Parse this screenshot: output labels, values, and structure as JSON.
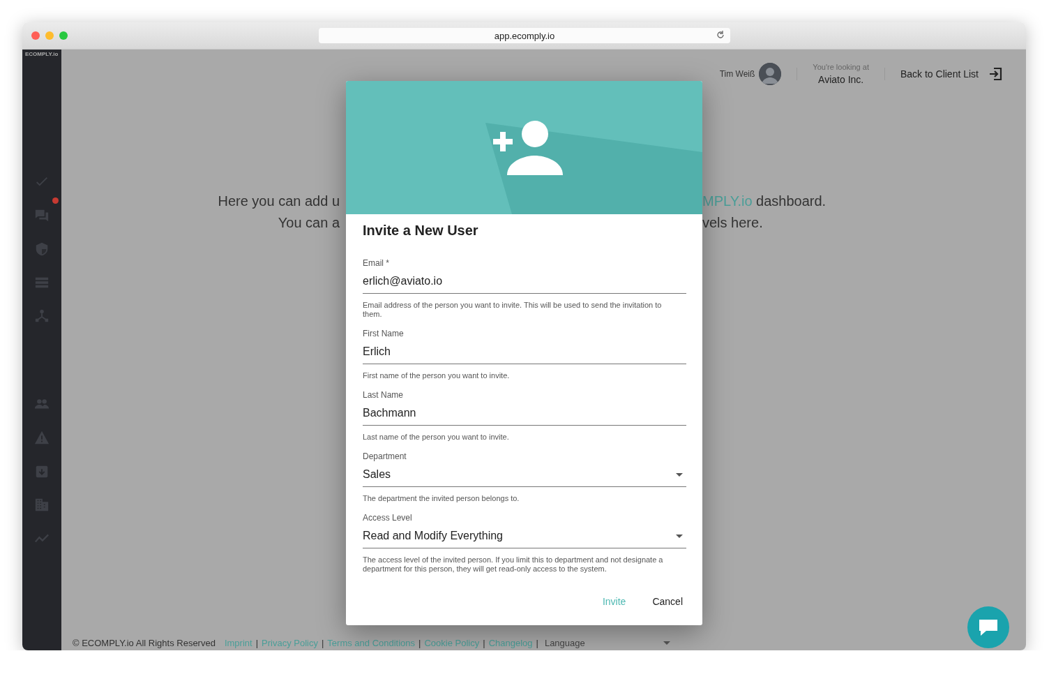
{
  "browser": {
    "url": "app.ecomply.io"
  },
  "sidebar": {
    "logo": "ECOMPLY.io",
    "items": [
      {
        "kind": "checks",
        "notification": false
      },
      {
        "kind": "chat",
        "notification": true
      },
      {
        "kind": "shield",
        "notification": false
      },
      {
        "kind": "list",
        "notification": false
      },
      {
        "kind": "network",
        "notification": false
      },
      {
        "kind": "people",
        "notification": false
      },
      {
        "kind": "warning",
        "notification": false
      },
      {
        "kind": "clipboard",
        "notification": false
      },
      {
        "kind": "building",
        "notification": false
      },
      {
        "kind": "chart",
        "notification": false
      }
    ]
  },
  "header": {
    "user_name": "Tim Weiß",
    "context_label": "You're looking at",
    "context_value": "Aviato Inc.",
    "back_link": "Back to Client List"
  },
  "background_text": {
    "line_1_left": "Here you can add u",
    "line_1_right_brand": "MPLY.io",
    "line_1_right": "dashboard.",
    "line_2_left": "You can a",
    "line_2_right": "vels here."
  },
  "dialog": {
    "title": "Invite a New User",
    "fields": [
      {
        "kind": "text",
        "label": "Email *",
        "value": "erlich@aviato.io",
        "helper": "Email address of the person you want to invite. This will be used to send the invitation to them."
      },
      {
        "kind": "text",
        "label": "First Name",
        "value": "Erlich",
        "helper": "First name of the person you want to invite."
      },
      {
        "kind": "text",
        "label": "Last Name",
        "value": "Bachmann",
        "helper": "Last name of the person you want to invite."
      },
      {
        "kind": "select",
        "label": "Department",
        "value": "Sales",
        "helper": "The department the invited person belongs to."
      },
      {
        "kind": "select",
        "label": "Access Level",
        "value": "Read and Modify Everything",
        "helper": "The access level of the invited person. If you limit this to department and not designate a department for this person, they will get read-only access to the system."
      }
    ],
    "actions": [
      {
        "kind": "primary",
        "label": "Invite"
      },
      {
        "kind": "secondary",
        "label": "Cancel"
      }
    ]
  },
  "footer": {
    "copyright": "© ECOMPLY.io All Rights Reserved",
    "separator": "|",
    "links": [
      "Imprint",
      "Privacy Policy",
      "Terms and Conditions",
      "Cookie Policy",
      "Changelog"
    ],
    "language_label": "Language"
  }
}
